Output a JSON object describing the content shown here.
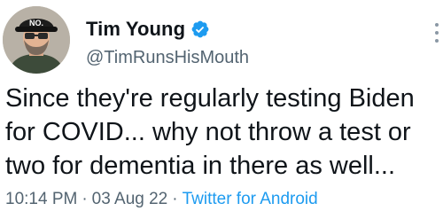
{
  "author": {
    "display_name": "Tim Young",
    "handle": "@TimRunsHisMouth",
    "verified_icon": "verified-badge-icon",
    "avatar_hat_text": "NO."
  },
  "tweet": {
    "text": "Since they're regularly testing Biden\nfor COVID... why not throw a test or\ntwo for dementia in there as well..."
  },
  "meta": {
    "time": "10:14 PM",
    "separator": "·",
    "date": "03 Aug 22",
    "source": "Twitter for Android"
  },
  "colors": {
    "text": "#0f1419",
    "secondary": "#536471",
    "accent": "#1d9bf0"
  }
}
